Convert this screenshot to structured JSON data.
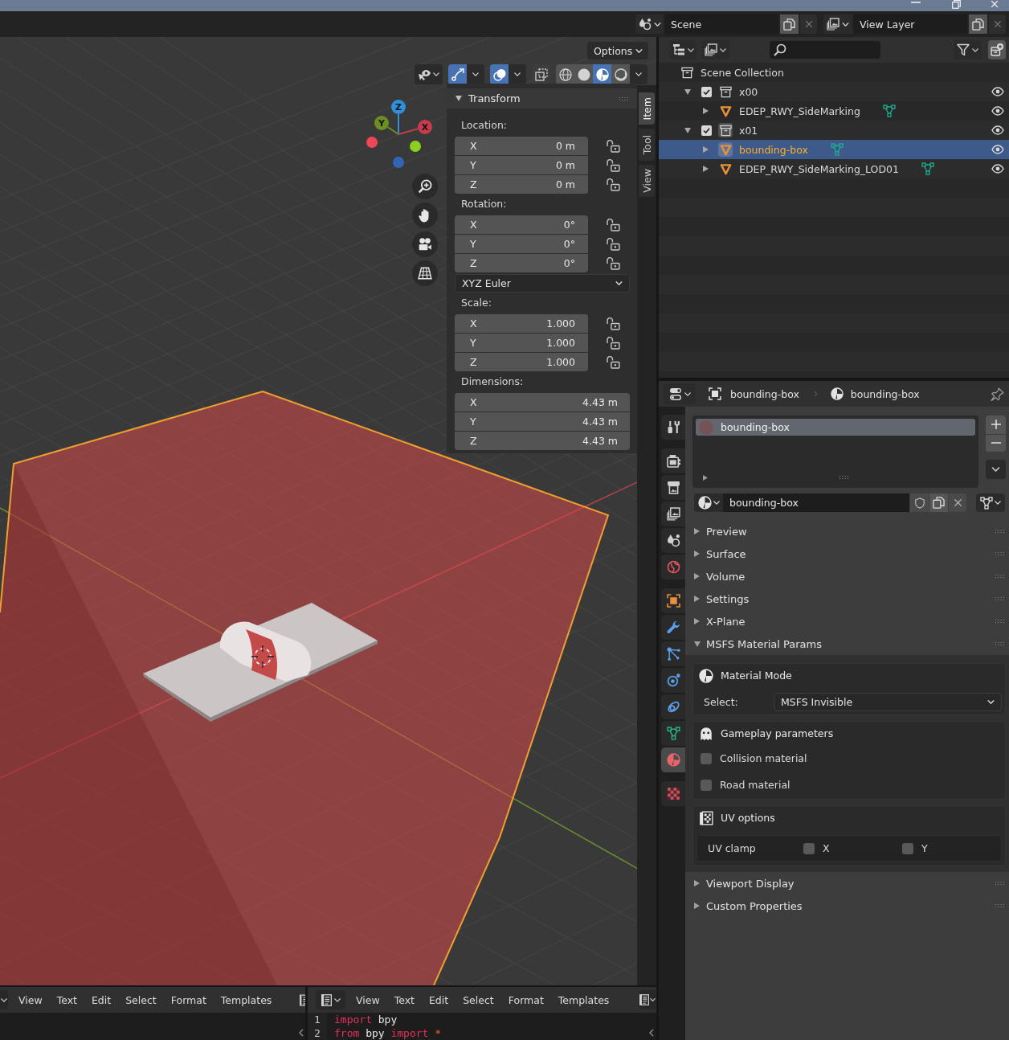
{
  "topbar": {
    "scene": "Scene",
    "view_layer": "View Layer"
  },
  "viewport": {
    "header": {
      "options": "Options",
      "toggles": [
        {
          "kind": "gizmos",
          "on": true
        },
        {
          "kind": "overlays",
          "on": true
        },
        {
          "kind": "xray",
          "on": false
        }
      ],
      "shading": [
        {
          "kind": "wireframe",
          "selected": false
        },
        {
          "kind": "solid",
          "selected": false
        },
        {
          "kind": "material",
          "selected": true
        },
        {
          "kind": "rendered",
          "selected": false
        }
      ]
    },
    "gizmo_axes": [
      {
        "label": "Z",
        "color": "#2e8fdd"
      },
      {
        "label": "Y",
        "color": "#6c8e23"
      },
      {
        "label": "X",
        "color": "#c63c4b"
      }
    ],
    "sidebar_tabs": [
      {
        "label": "Item",
        "selected": true
      },
      {
        "label": "Tool",
        "selected": false
      },
      {
        "label": "View",
        "selected": false
      }
    ],
    "transform": {
      "title": "Transform",
      "expanded": true,
      "sections": [
        {
          "kind": "vector",
          "label": "Location:",
          "fields": [
            {
              "axis": "X",
              "value": "0 m",
              "locked": false
            },
            {
              "axis": "Y",
              "value": "0 m",
              "locked": false
            },
            {
              "axis": "Z",
              "value": "0 m",
              "locked": false
            }
          ]
        },
        {
          "kind": "vector",
          "label": "Rotation:",
          "fields": [
            {
              "axis": "X",
              "value": "0°",
              "locked": false
            },
            {
              "axis": "Y",
              "value": "0°",
              "locked": false
            },
            {
              "axis": "Z",
              "value": "0°",
              "locked": false
            }
          ]
        },
        {
          "kind": "dropdown",
          "value": "XYZ Euler"
        },
        {
          "kind": "vector",
          "label": "Scale:",
          "fields": [
            {
              "axis": "X",
              "value": "1.000",
              "locked": false
            },
            {
              "axis": "Y",
              "value": "1.000",
              "locked": false
            },
            {
              "axis": "Z",
              "value": "1.000",
              "locked": false
            }
          ]
        },
        {
          "kind": "dimensions",
          "label": "Dimensions:",
          "fields": [
            {
              "axis": "X",
              "value": "4.43 m"
            },
            {
              "axis": "Y",
              "value": "4.43 m"
            },
            {
              "axis": "Z",
              "value": "4.43 m"
            }
          ]
        }
      ]
    }
  },
  "outliner": {
    "root": {
      "label": "Scene Collection",
      "selected": false,
      "children": [
        {
          "kind": "collection",
          "label": "x00",
          "expanded": true,
          "checked": true,
          "active": false,
          "selected": false,
          "visible": true,
          "children": [
            {
              "kind": "object",
              "label": "EDEP_RWY_SideMarking",
              "expanded": false,
              "active": false,
              "selected": false,
              "visible": true
            }
          ]
        },
        {
          "kind": "collection",
          "label": "x01",
          "expanded": true,
          "checked": true,
          "active": true,
          "selected": false,
          "visible": true,
          "children": [
            {
              "kind": "object",
              "label": "bounding-box",
              "expanded": false,
              "active": true,
              "selected": true,
              "visible": true
            },
            {
              "kind": "object",
              "label": "EDEP_RWY_SideMarking_LOD01",
              "expanded": false,
              "active": false,
              "selected": false,
              "visible": true
            }
          ]
        }
      ]
    }
  },
  "properties": {
    "breadcrumb": [
      {
        "kind": "object",
        "label": "bounding-box"
      },
      {
        "kind": "material",
        "label": "bounding-box"
      }
    ],
    "tab_groups": [
      {
        "tabs": [
          {
            "kind": "tool",
            "selected": false
          }
        ]
      },
      {
        "tabs": [
          {
            "kind": "render",
            "selected": false
          },
          {
            "kind": "output",
            "selected": false
          },
          {
            "kind": "viewlayer",
            "selected": false
          },
          {
            "kind": "scene",
            "selected": false
          },
          {
            "kind": "world",
            "selected": false
          }
        ]
      },
      {
        "tabs": [
          {
            "kind": "object",
            "selected": false
          },
          {
            "kind": "modifier",
            "selected": false
          },
          {
            "kind": "particles",
            "selected": false
          },
          {
            "kind": "physics",
            "selected": false
          },
          {
            "kind": "constraints",
            "selected": false
          },
          {
            "kind": "data",
            "selected": false
          },
          {
            "kind": "material",
            "selected": true
          }
        ]
      },
      {
        "tabs": [
          {
            "kind": "texture",
            "selected": false
          }
        ]
      }
    ],
    "material_slots": [
      {
        "label": "bounding-box",
        "selected": true
      }
    ],
    "material": {
      "name": "bounding-box",
      "fake_user": false
    },
    "panels": [
      {
        "label": "Preview",
        "expanded": false
      },
      {
        "label": "Surface",
        "expanded": false
      },
      {
        "label": "Volume",
        "expanded": false
      },
      {
        "label": "Settings",
        "expanded": false
      },
      {
        "label": "X-Plane",
        "expanded": false
      },
      {
        "label": "MSFS Material Params",
        "expanded": true,
        "boxes": [
          {
            "kind": "mode",
            "title": "Material Mode",
            "label": "Select:",
            "value": "MSFS Invisible"
          },
          {
            "kind": "gameplay",
            "title": "Gameplay parameters",
            "options": [
              {
                "label": "Collision material",
                "checked": false
              },
              {
                "label": "Road material",
                "checked": false
              }
            ]
          },
          {
            "kind": "uv",
            "title": "UV options",
            "label": "UV clamp",
            "options": [
              {
                "label": "X",
                "checked": false
              },
              {
                "label": "Y",
                "checked": false
              }
            ]
          }
        ]
      },
      {
        "label": "Viewport Display",
        "expanded": false
      },
      {
        "label": "Custom Properties",
        "expanded": false
      }
    ]
  },
  "text_editors": [
    {
      "menus": [
        "View",
        "Text",
        "Edit",
        "Select",
        "Format",
        "Templates"
      ]
    },
    {
      "menus": [
        "View",
        "Text",
        "Edit",
        "Select",
        "Format",
        "Templates"
      ],
      "lines": [
        {
          "number": "1",
          "tokens": [
            {
              "text": "import",
              "kind": "keyword"
            },
            {
              "text": "bpy",
              "kind": "plain"
            }
          ]
        },
        {
          "number": "2",
          "tokens": [
            {
              "text": "from",
              "kind": "keyword"
            },
            {
              "text": "bpy",
              "kind": "plain"
            },
            {
              "text": "import",
              "kind": "keyword"
            },
            {
              "text": "*",
              "kind": "operator"
            }
          ]
        }
      ]
    }
  ]
}
